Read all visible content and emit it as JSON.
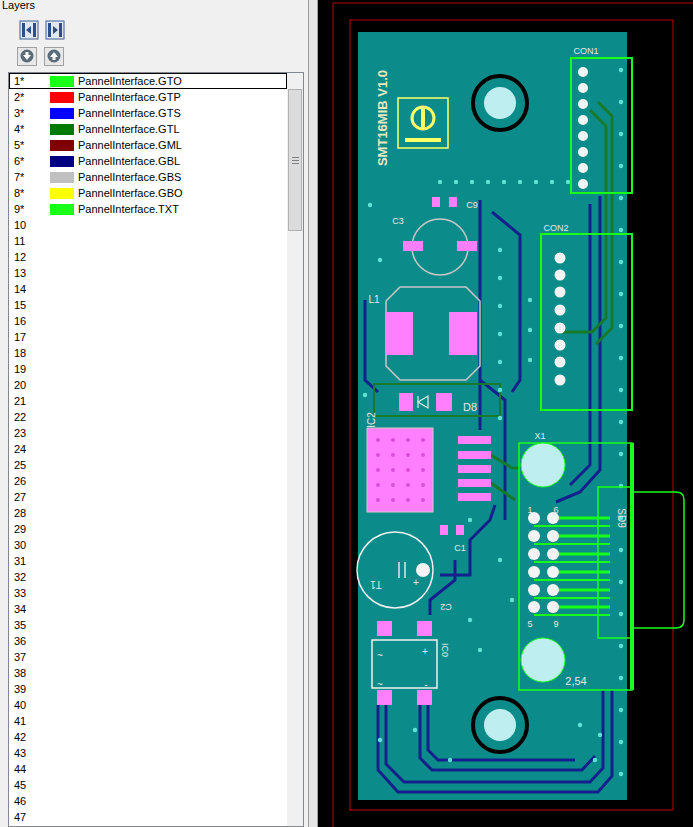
{
  "panel": {
    "title": "Layers"
  },
  "layers": [
    {
      "number": "1*",
      "name": "PannelInterface.GTO",
      "color": "#19ff19",
      "selected": true
    },
    {
      "number": "2*",
      "name": "PannelInterface.GTP",
      "color": "#ff0000",
      "selected": false
    },
    {
      "number": "3*",
      "name": "PannelInterface.GTS",
      "color": "#0000ff",
      "selected": false
    },
    {
      "number": "4*",
      "name": "PannelInterface.GTL",
      "color": "#007a00",
      "selected": false
    },
    {
      "number": "5*",
      "name": "PannelInterface.GML",
      "color": "#800000",
      "selected": false
    },
    {
      "number": "6*",
      "name": "PannelInterface.GBL",
      "color": "#000080",
      "selected": false
    },
    {
      "number": "7*",
      "name": "PannelInterface.GBS",
      "color": "#c0c0c0",
      "selected": false
    },
    {
      "number": "8*",
      "name": "PannelInterface.GBO",
      "color": "#ffff00",
      "selected": false
    },
    {
      "number": "9*",
      "name": "PannelInterface.TXT",
      "color": "#19ff19",
      "selected": false
    }
  ],
  "empty_rows": [
    "10",
    "11",
    "12",
    "13",
    "14",
    "15",
    "16",
    "17",
    "18",
    "19",
    "20",
    "21",
    "22",
    "23",
    "24",
    "25",
    "26",
    "27",
    "28",
    "29",
    "30",
    "31",
    "32",
    "33",
    "34",
    "35",
    "36",
    "37",
    "38",
    "39",
    "40",
    "41",
    "42",
    "43",
    "44",
    "45",
    "46",
    "47"
  ],
  "board": {
    "labels": [
      {
        "text": "SMT16MIB V1.0"
      },
      {
        "text": "CON1"
      },
      {
        "text": "CON2"
      },
      {
        "text": "C9"
      },
      {
        "text": "C3"
      },
      {
        "text": "L1"
      },
      {
        "text": "D8"
      },
      {
        "text": "IC2"
      },
      {
        "text": "X1"
      },
      {
        "text": "C1"
      },
      {
        "text": "T1"
      },
      {
        "text": "C2"
      },
      {
        "text": "IC0"
      },
      {
        "text": "SD9"
      },
      {
        "text": "2,54"
      },
      {
        "text": "1"
      },
      {
        "text": "5"
      },
      {
        "text": "6"
      },
      {
        "text": "9"
      },
      {
        "text": "+"
      },
      {
        "text": "~"
      },
      {
        "text": "~"
      },
      {
        "text": "-"
      },
      {
        "text": "+"
      }
    ]
  }
}
